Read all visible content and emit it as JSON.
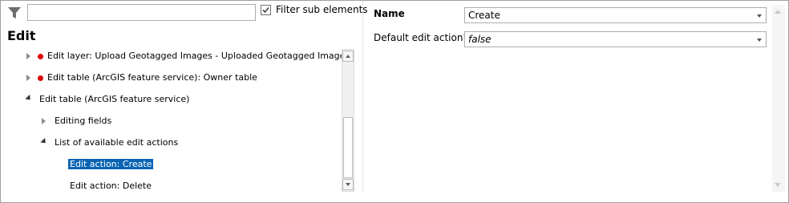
{
  "filter": {
    "placeholder": "",
    "checkbox_label": "Filter sub elements",
    "checked": true
  },
  "section_title": "Edit",
  "tree": [
    {
      "label": "Edit layer: Upload Geotagged Images - Uploaded Geotagged Images",
      "expanded": false,
      "error": true
    },
    {
      "label": "Edit table (ArcGIS feature service): Owner table",
      "expanded": false,
      "error": true
    },
    {
      "label": "Edit table (ArcGIS feature service)",
      "expanded": true,
      "error": false
    },
    {
      "label": "Editing fields",
      "expanded": false,
      "error": false
    },
    {
      "label": "List of available edit actions",
      "expanded": true,
      "error": false
    },
    {
      "label": "Edit action: Create",
      "selected": true
    },
    {
      "label": "Edit action: Delete",
      "selected": false
    }
  ],
  "properties": [
    {
      "label": "Name",
      "value": "Create",
      "italic": false
    },
    {
      "label": "Default edit action?",
      "value": "false",
      "italic": true
    }
  ],
  "colors": {
    "selection": "#0a64b4",
    "error_dot": "#e00000"
  }
}
